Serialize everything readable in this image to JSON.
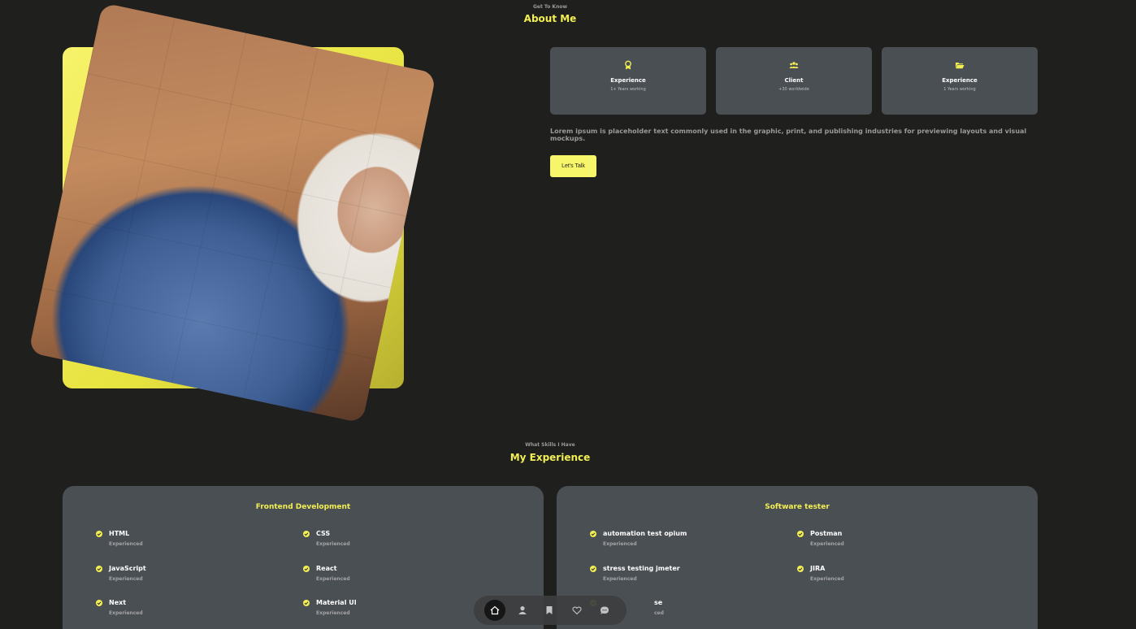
{
  "about": {
    "subtitle": "Get To Know",
    "title": "About Me",
    "cards": [
      {
        "icon": "award-icon",
        "title": "Experience",
        "subtitle": "1+ Years working"
      },
      {
        "icon": "users-icon",
        "title": "Client",
        "subtitle": "+30 worldwide"
      },
      {
        "icon": "folder-icon",
        "title": "Experience",
        "subtitle": "1 Years working"
      }
    ],
    "description": "Lorem ipsum is placeholder text commonly used in the graphic, print, and publishing industries for previewing layouts and visual mockups.",
    "cta_label": "Let's Talk"
  },
  "experience": {
    "subtitle": "What Skills I Have",
    "title": "My Experience",
    "panels": [
      {
        "title": "Frontend Development",
        "skills": [
          {
            "name": "HTML",
            "level": "Experienced"
          },
          {
            "name": "CSS",
            "level": "Experienced"
          },
          {
            "name": "JavaScript",
            "level": "Experienced"
          },
          {
            "name": "React",
            "level": "Experienced"
          },
          {
            "name": "Next",
            "level": "Experienced"
          },
          {
            "name": "Material UI",
            "level": "Experienced"
          }
        ]
      },
      {
        "title": "Software tester",
        "skills": [
          {
            "name": "automation test opium",
            "level": "Experienced"
          },
          {
            "name": "Postman",
            "level": "Experienced"
          },
          {
            "name": "stress testing jmeter",
            "level": "Experienced"
          },
          {
            "name": "JIRA",
            "level": "Experienced"
          },
          {
            "name": "se",
            "level": "ced"
          }
        ]
      }
    ]
  },
  "nav": {
    "items": [
      "home-icon",
      "user-icon",
      "bookmark-icon",
      "services-icon",
      "message-icon"
    ],
    "active": "home-icon"
  },
  "colors": {
    "accent": "#f2ef52",
    "background": "#1f1f1e",
    "card": "#4a4f54"
  }
}
